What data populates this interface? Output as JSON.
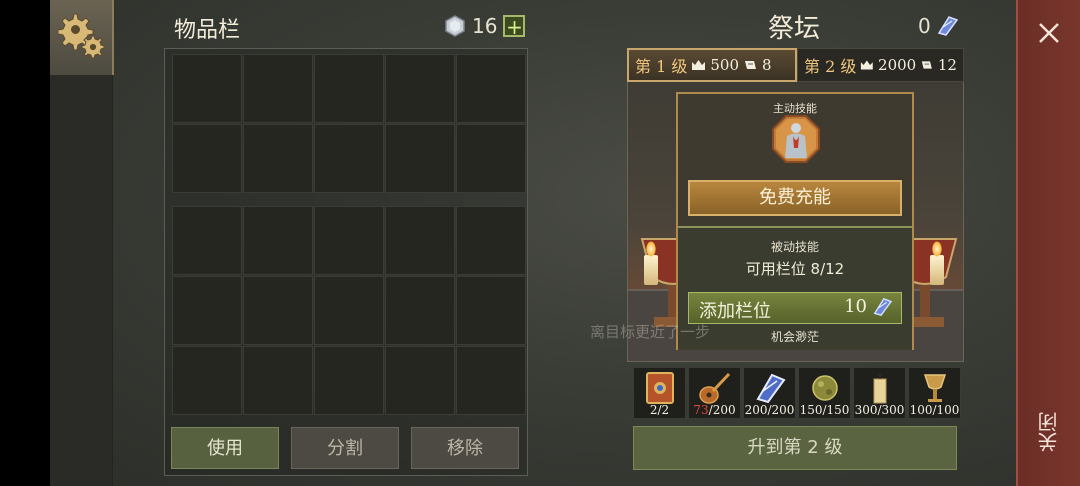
{
  "inventory": {
    "title": "物品栏",
    "gem_count": "16",
    "plus_label": "+",
    "buttons": {
      "use": "使用",
      "split": "分割",
      "remove": "移除"
    }
  },
  "altar": {
    "title": "祭坛",
    "crystal_count": "0",
    "tabs": [
      {
        "label": "第 1 级",
        "cost_a": "500",
        "cost_b": "8",
        "active": true
      },
      {
        "label": "第 2 级",
        "cost_a": "2000",
        "cost_b": "12",
        "active": false
      }
    ],
    "active_skill_label": "主动技能",
    "free_charge_label": "免费充能",
    "passive_skill_label": "被动技能",
    "slots_label": "可用栏位 8/12",
    "add_slot_label": "添加栏位",
    "add_slot_cost": "10",
    "chance_label": "机会渺茫",
    "ghost_text": "离目标更近了一步",
    "items": [
      {
        "icon": "book-icon",
        "have": "2",
        "need": "/2",
        "short": false
      },
      {
        "icon": "lute-icon",
        "have": "73",
        "need": "/200",
        "short": true
      },
      {
        "icon": "crystal-icon",
        "have": "200",
        "need": "/200",
        "short": false
      },
      {
        "icon": "orb-icon",
        "have": "150",
        "need": "/150",
        "short": false
      },
      {
        "icon": "candle-icon",
        "have": "300",
        "need": "/300",
        "short": false
      },
      {
        "icon": "goblet-icon",
        "have": "100",
        "need": "/100",
        "short": false
      }
    ],
    "upgrade_label": "升到第 2 级"
  },
  "close_label": "关闭",
  "colors": {
    "accent_gold": "#c9a76a",
    "button_green": "#5a6441",
    "close_red": "#7a362c",
    "shortage_red": "#e04a3a"
  }
}
